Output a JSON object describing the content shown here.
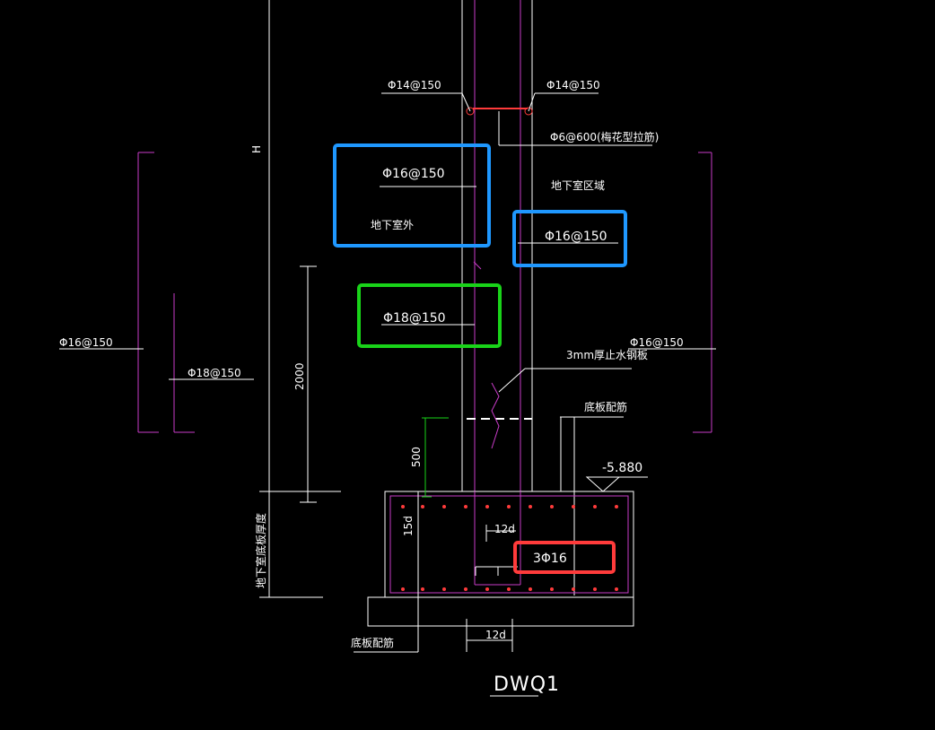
{
  "labels": {
    "phi14_left": "Φ14@150",
    "phi14_right": "Φ14@150",
    "phi6_tie": "Φ6@600(梅花型拉筋)",
    "underground_area": "地下室区域",
    "phi16_outer_box": "Φ16@150",
    "outside_basement": "地下室外",
    "phi16_inner_box": "Φ16@150",
    "phi18_box": "Φ18@150",
    "phi16_left": "Φ16@150",
    "phi18_left": "Φ18@150",
    "phi16_right": "Φ16@150",
    "waterstop": "3mm厚止水钢板",
    "bottom_slab_rebar_top": "底板配筋",
    "elevation": "-5.880",
    "dim_2000": "2000",
    "dim_500": "500",
    "dim_15d": "15d",
    "dim_12d_upper": "12d",
    "three_phi16": "3Φ16",
    "dim_12d_lower": "12d",
    "bottom_slab_rebar_bottom": "底板配筋",
    "basement_floor_depth": "地下室底板厚度",
    "h_axis": "H",
    "title": "DWQ1"
  },
  "annotation_boxes": {
    "blue": "#1f98ff",
    "green": "#19d319",
    "red": "#ff3b3b"
  },
  "colors": {
    "background": "#000000",
    "line_primary": "#ffffff",
    "line_magenta": "#c93cc9",
    "line_green": "#19d319",
    "line_red": "#ff3b3b"
  }
}
